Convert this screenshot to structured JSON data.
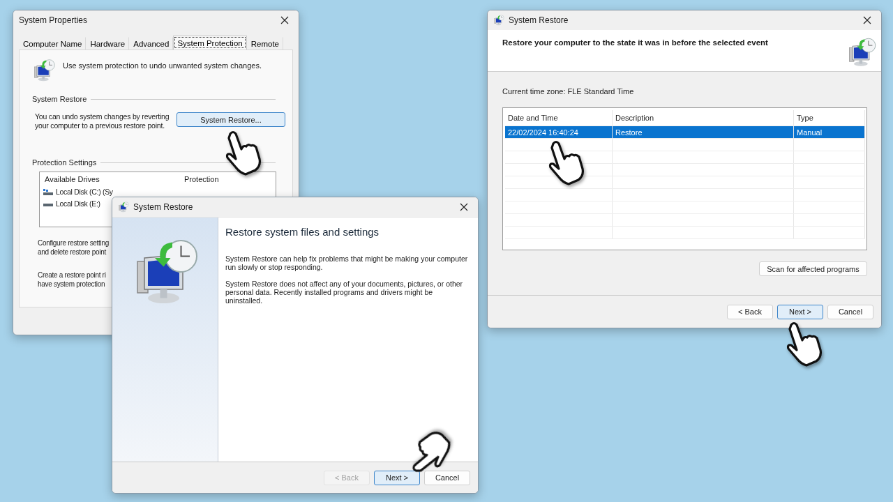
{
  "system_properties": {
    "title": "System Properties",
    "tabs": [
      {
        "label": "Computer Name",
        "selected": false
      },
      {
        "label": "Hardware",
        "selected": false
      },
      {
        "label": "Advanced",
        "selected": false
      },
      {
        "label": "System Protection",
        "selected": true
      },
      {
        "label": "Remote",
        "selected": false
      }
    ],
    "intro": "Use system protection to undo unwanted system changes.",
    "restore_group": {
      "heading": "System Restore",
      "description": "You can undo system changes by reverting your computer to a previous restore point.",
      "button": {
        "label": "System Restore...",
        "highlighted": true
      }
    },
    "protection_group": {
      "heading": "Protection Settings",
      "columns": [
        "Available Drives",
        "Protection"
      ],
      "drives": [
        {
          "kind": "system",
          "name": "Local Disk (C:) (Sy"
        },
        {
          "kind": "data",
          "name": "Local Disk (E:)"
        }
      ],
      "notes": [
        [
          "Configure restore setting",
          "and delete restore point"
        ],
        [
          "Create a restore point ri",
          "have system protection"
        ]
      ]
    }
  },
  "restore_intro": {
    "title": "System Restore",
    "heading": "Restore system files and settings",
    "paragraphs": [
      "System Restore can help fix problems that might be making your computer run slowly or stop responding.",
      "System Restore does not affect any of your documents, pictures, or other personal data. Recently installed programs and drivers might be uninstalled."
    ],
    "buttons": [
      {
        "label": "< Back",
        "disabled": true,
        "default": false
      },
      {
        "label": "Next >",
        "disabled": false,
        "default": true
      },
      {
        "label": "Cancel",
        "disabled": false,
        "default": false
      }
    ]
  },
  "restore_select": {
    "title": "System Restore",
    "heading": "Restore your computer to the state it was in before the selected event",
    "timezone": "Current time zone: FLE Standard Time",
    "table": {
      "columns": [
        "Date and Time",
        "Description",
        "Type"
      ],
      "rows": [
        {
          "cells": [
            "22/02/2024 16:40:24",
            "Restore",
            "Manual"
          ],
          "selected": true
        }
      ]
    },
    "scan_button": "Scan for affected programs",
    "buttons": [
      {
        "label": "< Back",
        "disabled": false,
        "default": false
      },
      {
        "label": "Next >",
        "disabled": false,
        "default": true
      },
      {
        "label": "Cancel",
        "disabled": false,
        "default": false
      }
    ]
  }
}
